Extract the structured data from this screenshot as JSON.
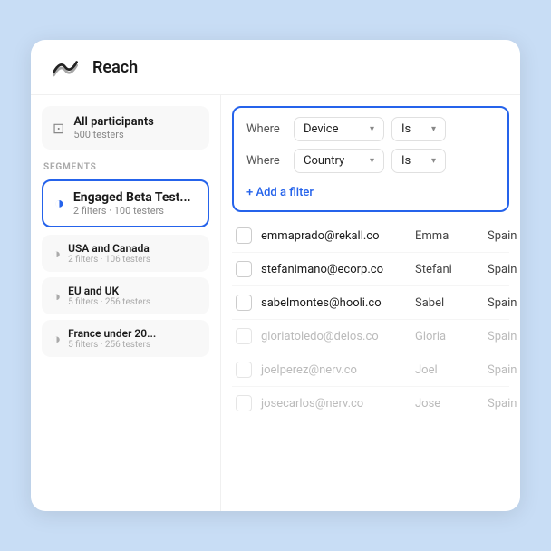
{
  "header": {
    "title": "Reach"
  },
  "sidebar": {
    "allParticipants": {
      "label": "All participants",
      "count": "500 testers"
    },
    "segmentsLabel": "SEGMENTS",
    "activeSegment": {
      "name": "Engaged Beta Test...",
      "sub": "2 filters · 100 testers"
    },
    "segments": [
      {
        "name": "USA and Canada",
        "sub": "2 filters · 106 testers"
      },
      {
        "name": "EU and UK",
        "sub": "5 filters · 256 testers"
      },
      {
        "name": "France under 20...",
        "sub": "5 filters · 256 testers"
      }
    ]
  },
  "filters": {
    "rows": [
      {
        "label": "Where",
        "field": "Device",
        "operator": "Is"
      },
      {
        "label": "Where",
        "field": "Country",
        "operator": "Is"
      }
    ],
    "addFilterLabel": "+ Add a filter"
  },
  "table": {
    "rows": [
      {
        "email": "emmaprado@rekall.co",
        "firstName": "Emma",
        "country": "Spain",
        "dimmed": false,
        "checked": false
      },
      {
        "email": "stefanimano@ecorp.co",
        "firstName": "Stefani",
        "country": "Spain",
        "dimmed": false,
        "checked": false
      },
      {
        "email": "sabelmontes@hooli.co",
        "firstName": "Sabel",
        "country": "Spain",
        "dimmed": false,
        "checked": false
      },
      {
        "email": "gloriatoledo@delos.co",
        "firstName": "Gloria",
        "country": "Spain",
        "dimmed": true,
        "checked": false
      },
      {
        "email": "joelperez@nerv.co",
        "firstName": "Joel",
        "country": "Spain",
        "dimmed": true,
        "checked": false
      },
      {
        "email": "josecarlos@nerv.co",
        "firstName": "Jose",
        "country": "Spain",
        "dimmed": true,
        "checked": false
      }
    ]
  },
  "icons": {
    "logo": "∧∧",
    "participants": "⊡",
    "segmentActive": "◑",
    "segmentItem": "◑",
    "chevron": "▾"
  }
}
